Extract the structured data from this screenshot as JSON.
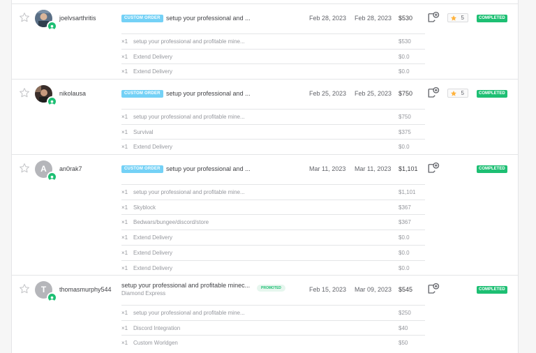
{
  "orders": [
    {
      "username": "joelvsarthritis",
      "avatar": "photo",
      "initial": "",
      "badge": "CUSTOM ORDER",
      "title": "setup your professional and ...",
      "subtitle": "",
      "promoted": "",
      "order_date": "Feb 28, 2023",
      "due_date": "Feb 28, 2023",
      "price": "$530",
      "rating": "5",
      "status": "COMPLETED",
      "items": [
        {
          "qty": "×1",
          "name": "setup your professional and profitable mine...",
          "price": "$530"
        },
        {
          "qty": "×1",
          "name": "Extend Delivery",
          "price": "$0.0"
        },
        {
          "qty": "×1",
          "name": "Extend Delivery",
          "price": "$0.0"
        }
      ]
    },
    {
      "username": "nikolausa",
      "avatar": "photo",
      "initial": "",
      "badge": "CUSTOM ORDER",
      "title": "setup your professional and ...",
      "subtitle": "",
      "promoted": "",
      "order_date": "Feb 25, 2023",
      "due_date": "Feb 25, 2023",
      "price": "$750",
      "rating": "5",
      "status": "COMPLETED",
      "items": [
        {
          "qty": "×1",
          "name": "setup your professional and profitable mine...",
          "price": "$750"
        },
        {
          "qty": "×1",
          "name": "Survival",
          "price": "$375"
        },
        {
          "qty": "×1",
          "name": "Extend Delivery",
          "price": "$0.0"
        }
      ]
    },
    {
      "username": "an0rak7",
      "avatar": "initial",
      "initial": "A",
      "badge": "CUSTOM ORDER",
      "title": "setup your professional and ...",
      "subtitle": "",
      "promoted": "",
      "order_date": "Mar 11, 2023",
      "due_date": "Mar 11, 2023",
      "price": "$1,101",
      "rating": "",
      "status": "COMPLETED",
      "items": [
        {
          "qty": "×1",
          "name": "setup your professional and profitable mine...",
          "price": "$1,101"
        },
        {
          "qty": "×1",
          "name": "Skyblock",
          "price": "$367"
        },
        {
          "qty": "×1",
          "name": "Bedwars/bungee/discord/store",
          "price": "$367"
        },
        {
          "qty": "×1",
          "name": "Extend Delivery",
          "price": "$0.0"
        },
        {
          "qty": "×1",
          "name": "Extend Delivery",
          "price": "$0.0"
        },
        {
          "qty": "×1",
          "name": "Extend Delivery",
          "price": "$0.0"
        }
      ]
    },
    {
      "username": "thomasmurphy544",
      "avatar": "initial",
      "initial": "T",
      "badge": "",
      "title": "setup your professional and profitable minec...",
      "subtitle": "Diamond Express",
      "promoted": "PROMOTED",
      "order_date": "Feb 15, 2023",
      "due_date": "Mar 09, 2023",
      "price": "$545",
      "rating": "",
      "status": "COMPLETED",
      "items": [
        {
          "qty": "×1",
          "name": "setup your professional and profitable mine...",
          "price": "$250"
        },
        {
          "qty": "×1",
          "name": "Discord Integration",
          "price": "$40"
        },
        {
          "qty": "×1",
          "name": "Custom Worldgen",
          "price": "$50"
        }
      ]
    }
  ],
  "colors": {
    "accent_green": "#1dbf73",
    "custom_badge": "#74d1f6",
    "star_rating": "#ffb33e"
  },
  "icons": {
    "favorite": "star-outline-icon",
    "note": "add-note-icon",
    "rating": "star-filled-icon",
    "online": "user-online-icon"
  }
}
